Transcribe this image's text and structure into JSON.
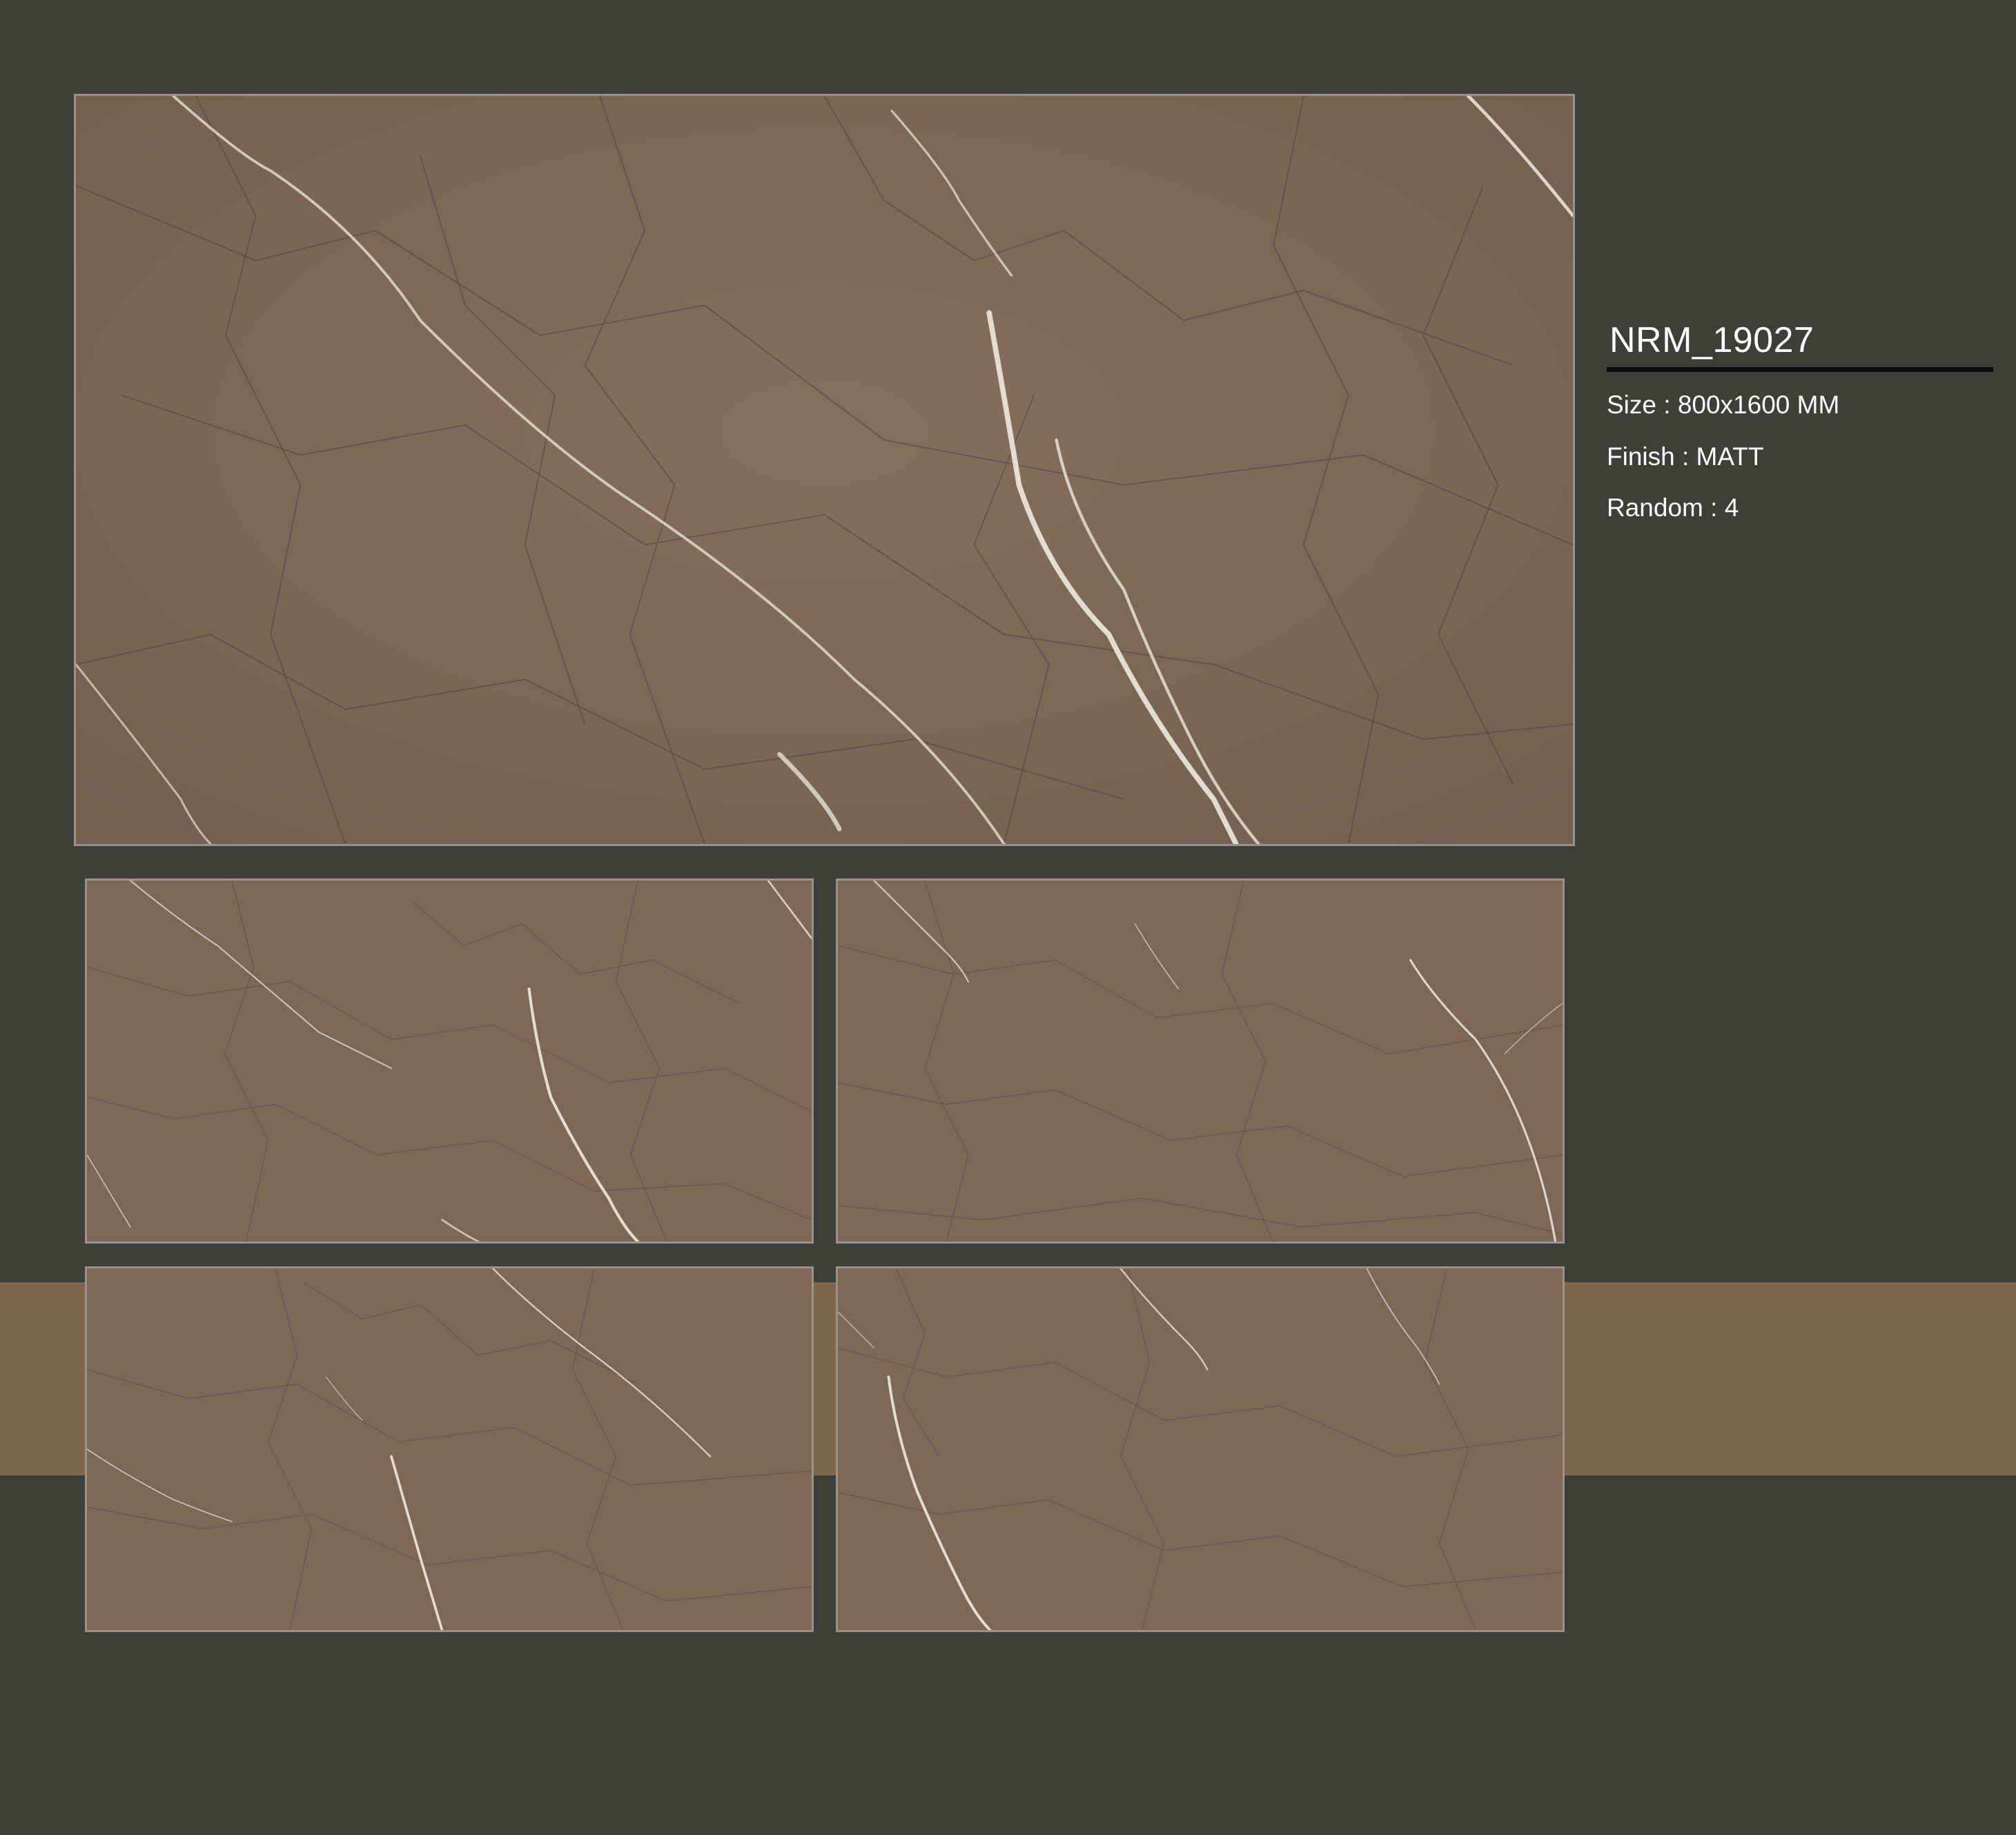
{
  "product": {
    "code": "NRM_19027",
    "specs": [
      {
        "label": "Size",
        "value": "800x1600 MM"
      },
      {
        "label": "Finish",
        "value": "MATT"
      },
      {
        "label": "Random",
        "value": "4"
      }
    ]
  },
  "colors": {
    "background": "#3e3f3a",
    "accent_band": "#7e654d",
    "tile_base": "#7e6a5a",
    "tile_border": "#9b938a",
    "vein": "#efe9df",
    "crack": "#4e3e32",
    "heading_underline": "#0b0b0b",
    "text": "#ffffff"
  }
}
